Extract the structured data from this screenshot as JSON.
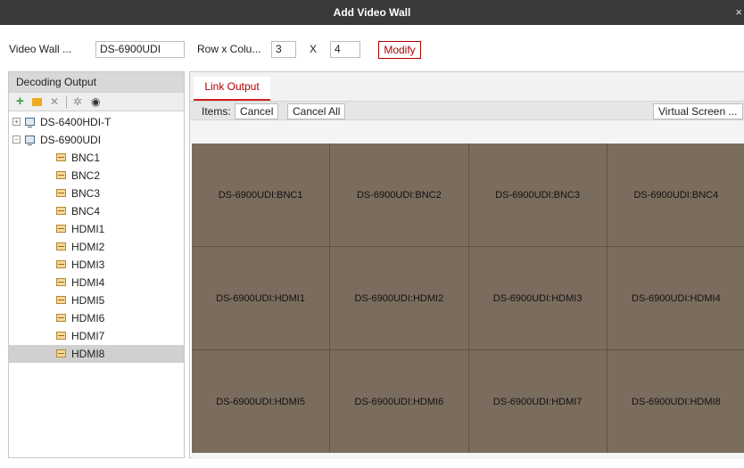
{
  "window": {
    "title": "Add Video Wall",
    "close_glyph": "×"
  },
  "config": {
    "video_wall_label": "Video Wall ...",
    "video_wall_value": "DS-6900UDI",
    "rowcol_label": "Row x Colu...",
    "rows": "3",
    "x_label": "X",
    "cols": "4",
    "modify_label": "Modify"
  },
  "left_panel": {
    "header": "Decoding Output",
    "toolbar": [
      "add-icon",
      "folder-icon",
      "delete-icon",
      "settings-icon",
      "view-icon"
    ],
    "tree": [
      {
        "label": "DS-6400HDI-T",
        "level": 0,
        "expander": "⊞",
        "icon": "device-icon"
      },
      {
        "label": "DS-6900UDI",
        "level": 0,
        "expander": "⊟",
        "icon": "device-icon"
      },
      {
        "label": "BNC1",
        "level": 1,
        "icon": "output-icon"
      },
      {
        "label": "BNC2",
        "level": 1,
        "icon": "output-icon"
      },
      {
        "label": "BNC3",
        "level": 1,
        "icon": "output-icon"
      },
      {
        "label": "BNC4",
        "level": 1,
        "icon": "output-icon"
      },
      {
        "label": "HDMI1",
        "level": 1,
        "icon": "output-icon"
      },
      {
        "label": "HDMI2",
        "level": 1,
        "icon": "output-icon"
      },
      {
        "label": "HDMI3",
        "level": 1,
        "icon": "output-icon"
      },
      {
        "label": "HDMI4",
        "level": 1,
        "icon": "output-icon"
      },
      {
        "label": "HDMI5",
        "level": 1,
        "icon": "output-icon"
      },
      {
        "label": "HDMI6",
        "level": 1,
        "icon": "output-icon"
      },
      {
        "label": "HDMI7",
        "level": 1,
        "icon": "output-icon"
      },
      {
        "label": "HDMI8",
        "level": 1,
        "icon": "output-icon",
        "selected": true
      }
    ]
  },
  "right_panel": {
    "tab": "Link Output",
    "items_label": "Items:",
    "cancel_label": "Cancel",
    "cancel_all_label": "Cancel All",
    "virtual_screen_label": "Virtual Screen ...",
    "cells": [
      "DS-6900UDI:BNC1",
      "DS-6900UDI:BNC2",
      "DS-6900UDI:BNC3",
      "DS-6900UDI:BNC4",
      "DS-6900UDI:HDMI1",
      "DS-6900UDI:HDMI2",
      "DS-6900UDI:HDMI3",
      "DS-6900UDI:HDMI4",
      "DS-6900UDI:HDMI5",
      "DS-6900UDI:HDMI6",
      "DS-6900UDI:HDMI7",
      "DS-6900UDI:HDMI8"
    ]
  },
  "colors": {
    "titlebar": "#3a3a3a",
    "accent_red": "#b00000",
    "wall_cell": "#7b6d5e",
    "selection": "#d0d0d0"
  }
}
